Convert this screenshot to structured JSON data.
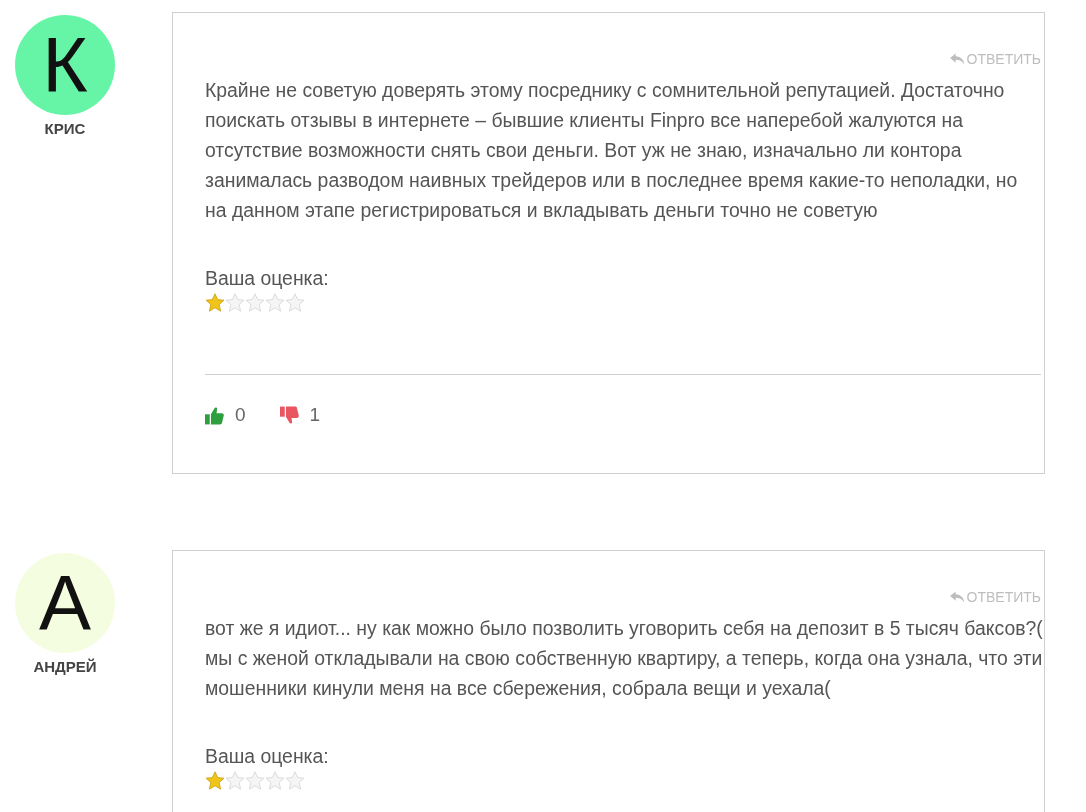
{
  "comments": [
    {
      "author": {
        "initial": "К",
        "name": "КРИС",
        "color": "#66f5a6"
      },
      "reply_label": "ОТВЕТИТЬ",
      "text": "Крайне не советую доверять этому посреднику с сомнительной репутацией. Достаточно поискать отзывы в интернете – бывшие клиенты Finpro все наперебой жалуются на отсутствие возможности снять свои деньги. Вот уж не знаю, изначально ли контора занималась разводом наивных трейдеров или в последнее время какие-то неполадки, но на данном этапе регистрироваться и вкладывать деньги точно не советую",
      "rating_label": "Ваша оценка:",
      "stars": 1,
      "votes": {
        "up": "0",
        "down": "1"
      }
    },
    {
      "author": {
        "initial": "А",
        "name": "АНДРЕЙ",
        "color": "#f5fde0"
      },
      "reply_label": "ОТВЕТИТЬ",
      "text": "вот же я идиот... ну как можно было позволить уговорить себя на депозит в 5 тысяч баксов?( мы с женой откладывали на свою собственную квартиру, а теперь, когда она узнала, что эти мошенники кинули меня на все сбережения, собрала вещи и уехала(",
      "rating_label": "Ваша оценка:",
      "stars": 1
    }
  ]
}
